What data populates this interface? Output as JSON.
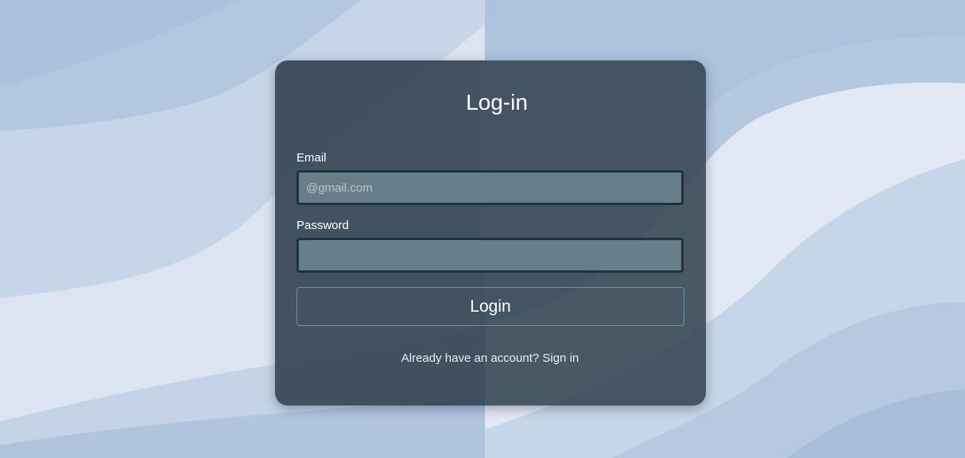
{
  "colors": {
    "background_light": "#dce4f1",
    "background_mid": "#c5d3e6",
    "background_dark": "#aec3dc",
    "card": "#2e3e4c",
    "input_fill": "#687f8b",
    "input_border": "#18363b",
    "button_border": "#5a9aa3",
    "text": "#ffffff"
  },
  "login_card": {
    "title": "Log-in",
    "email": {
      "label": "Email",
      "value": "",
      "placeholder": "@gmail.com"
    },
    "password": {
      "label": "Password",
      "value": "",
      "placeholder": ""
    },
    "login_button_label": "Login",
    "footer": {
      "prompt": "Already have an account?",
      "link_label": "Sign in"
    }
  }
}
